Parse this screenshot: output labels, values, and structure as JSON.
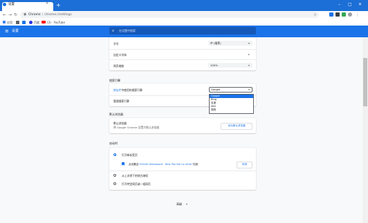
{
  "browser": {
    "tab_title": "设置",
    "omnibox": {
      "site": "Chrome",
      "url": "chrome://settings"
    },
    "bookmarks": [
      {
        "label": "应用",
        "icon": "apps-icon"
      },
      {
        "label": "",
        "icon": "bookmark-favicon-icon"
      },
      {
        "label": "",
        "icon": "bookmark-favicon-icon"
      },
      {
        "label": "百度",
        "icon": "baidu-icon"
      },
      {
        "label": "(3) - YouTube",
        "icon": "youtube-icon"
      }
    ]
  },
  "header": {
    "title": "设置",
    "search_placeholder": "在设置中搜索"
  },
  "appearance": {
    "font_size_label": "字号",
    "font_size_value": "中 (推荐)",
    "custom_fonts_label": "自定义字体",
    "page_zoom_label": "网页缩放",
    "page_zoom_value": "100%"
  },
  "search_engine": {
    "section_title": "搜索引擎",
    "address_bar_link": "地址栏",
    "address_bar_text": "中使用的搜索引擎",
    "selected": "Google",
    "manage_label": "管理搜索引擎",
    "options": [
      "Google",
      "Bing",
      "百度",
      "360",
      "搜狗"
    ]
  },
  "default_browser": {
    "section_title": "默认浏览器",
    "label": "默认浏览器",
    "description": "将 Google Chrome 设置为默认浏览器",
    "button": "设为默认浏览器"
  },
  "on_startup": {
    "section_title": "启动时",
    "options": [
      "打开新标签页",
      "从上次停下的地方继续",
      "打开特定网页或一组网页"
    ],
    "extension_prefix": "此设置由",
    "extension_name": "\"Infinite Dashboard - New Tab like no other\"",
    "extension_suffix": "控制",
    "disable_button": "停用"
  },
  "footer": {
    "advanced_label": "高级"
  },
  "colors": {
    "accent": "#1a73e8",
    "titlebar": "#1c6fd6",
    "header": "#1a73e8"
  }
}
